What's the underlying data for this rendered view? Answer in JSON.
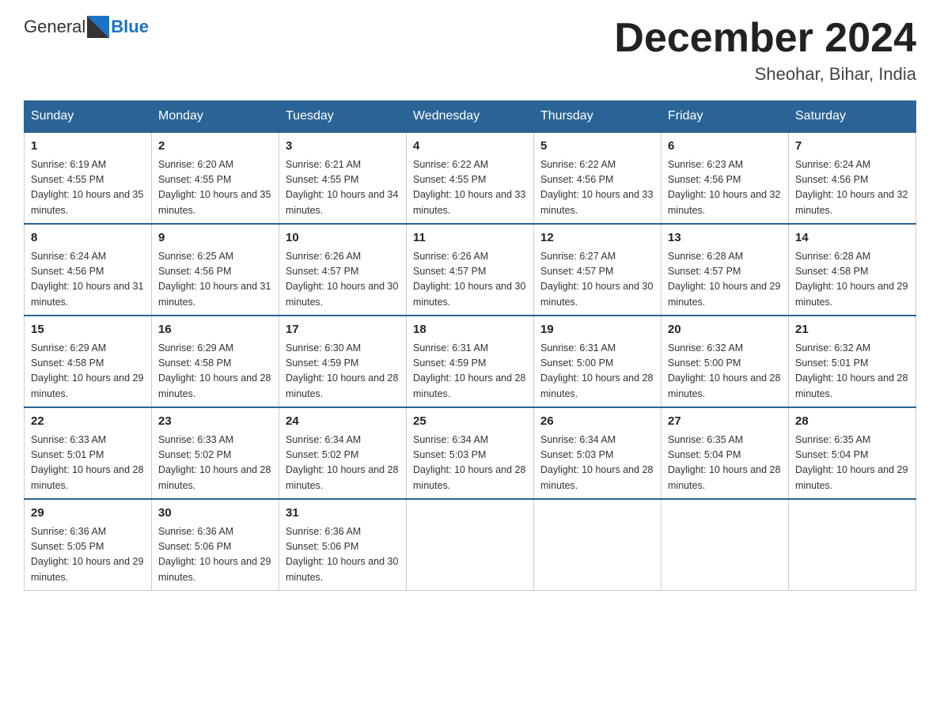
{
  "header": {
    "logo_text_general": "General",
    "logo_text_blue": "Blue",
    "month_title": "December 2024",
    "location": "Sheohar, Bihar, India"
  },
  "days_of_week": [
    "Sunday",
    "Monday",
    "Tuesday",
    "Wednesday",
    "Thursday",
    "Friday",
    "Saturday"
  ],
  "weeks": [
    [
      {
        "day": "1",
        "sunrise": "6:19 AM",
        "sunset": "4:55 PM",
        "daylight": "10 hours and 35 minutes."
      },
      {
        "day": "2",
        "sunrise": "6:20 AM",
        "sunset": "4:55 PM",
        "daylight": "10 hours and 35 minutes."
      },
      {
        "day": "3",
        "sunrise": "6:21 AM",
        "sunset": "4:55 PM",
        "daylight": "10 hours and 34 minutes."
      },
      {
        "day": "4",
        "sunrise": "6:22 AM",
        "sunset": "4:55 PM",
        "daylight": "10 hours and 33 minutes."
      },
      {
        "day": "5",
        "sunrise": "6:22 AM",
        "sunset": "4:56 PM",
        "daylight": "10 hours and 33 minutes."
      },
      {
        "day": "6",
        "sunrise": "6:23 AM",
        "sunset": "4:56 PM",
        "daylight": "10 hours and 32 minutes."
      },
      {
        "day": "7",
        "sunrise": "6:24 AM",
        "sunset": "4:56 PM",
        "daylight": "10 hours and 32 minutes."
      }
    ],
    [
      {
        "day": "8",
        "sunrise": "6:24 AM",
        "sunset": "4:56 PM",
        "daylight": "10 hours and 31 minutes."
      },
      {
        "day": "9",
        "sunrise": "6:25 AM",
        "sunset": "4:56 PM",
        "daylight": "10 hours and 31 minutes."
      },
      {
        "day": "10",
        "sunrise": "6:26 AM",
        "sunset": "4:57 PM",
        "daylight": "10 hours and 30 minutes."
      },
      {
        "day": "11",
        "sunrise": "6:26 AM",
        "sunset": "4:57 PM",
        "daylight": "10 hours and 30 minutes."
      },
      {
        "day": "12",
        "sunrise": "6:27 AM",
        "sunset": "4:57 PM",
        "daylight": "10 hours and 30 minutes."
      },
      {
        "day": "13",
        "sunrise": "6:28 AM",
        "sunset": "4:57 PM",
        "daylight": "10 hours and 29 minutes."
      },
      {
        "day": "14",
        "sunrise": "6:28 AM",
        "sunset": "4:58 PM",
        "daylight": "10 hours and 29 minutes."
      }
    ],
    [
      {
        "day": "15",
        "sunrise": "6:29 AM",
        "sunset": "4:58 PM",
        "daylight": "10 hours and 29 minutes."
      },
      {
        "day": "16",
        "sunrise": "6:29 AM",
        "sunset": "4:58 PM",
        "daylight": "10 hours and 28 minutes."
      },
      {
        "day": "17",
        "sunrise": "6:30 AM",
        "sunset": "4:59 PM",
        "daylight": "10 hours and 28 minutes."
      },
      {
        "day": "18",
        "sunrise": "6:31 AM",
        "sunset": "4:59 PM",
        "daylight": "10 hours and 28 minutes."
      },
      {
        "day": "19",
        "sunrise": "6:31 AM",
        "sunset": "5:00 PM",
        "daylight": "10 hours and 28 minutes."
      },
      {
        "day": "20",
        "sunrise": "6:32 AM",
        "sunset": "5:00 PM",
        "daylight": "10 hours and 28 minutes."
      },
      {
        "day": "21",
        "sunrise": "6:32 AM",
        "sunset": "5:01 PM",
        "daylight": "10 hours and 28 minutes."
      }
    ],
    [
      {
        "day": "22",
        "sunrise": "6:33 AM",
        "sunset": "5:01 PM",
        "daylight": "10 hours and 28 minutes."
      },
      {
        "day": "23",
        "sunrise": "6:33 AM",
        "sunset": "5:02 PM",
        "daylight": "10 hours and 28 minutes."
      },
      {
        "day": "24",
        "sunrise": "6:34 AM",
        "sunset": "5:02 PM",
        "daylight": "10 hours and 28 minutes."
      },
      {
        "day": "25",
        "sunrise": "6:34 AM",
        "sunset": "5:03 PM",
        "daylight": "10 hours and 28 minutes."
      },
      {
        "day": "26",
        "sunrise": "6:34 AM",
        "sunset": "5:03 PM",
        "daylight": "10 hours and 28 minutes."
      },
      {
        "day": "27",
        "sunrise": "6:35 AM",
        "sunset": "5:04 PM",
        "daylight": "10 hours and 28 minutes."
      },
      {
        "day": "28",
        "sunrise": "6:35 AM",
        "sunset": "5:04 PM",
        "daylight": "10 hours and 29 minutes."
      }
    ],
    [
      {
        "day": "29",
        "sunrise": "6:36 AM",
        "sunset": "5:05 PM",
        "daylight": "10 hours and 29 minutes."
      },
      {
        "day": "30",
        "sunrise": "6:36 AM",
        "sunset": "5:06 PM",
        "daylight": "10 hours and 29 minutes."
      },
      {
        "day": "31",
        "sunrise": "6:36 AM",
        "sunset": "5:06 PM",
        "daylight": "10 hours and 30 minutes."
      },
      null,
      null,
      null,
      null
    ]
  ],
  "labels": {
    "sunrise": "Sunrise:",
    "sunset": "Sunset:",
    "daylight": "Daylight:"
  }
}
